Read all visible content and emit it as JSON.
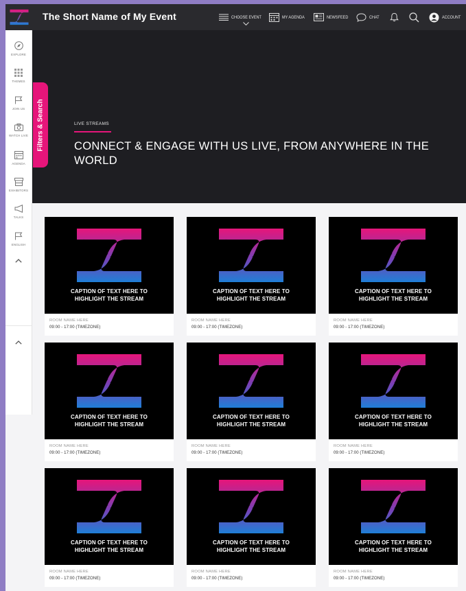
{
  "header": {
    "title": "The Short Name of My Event",
    "nav": [
      {
        "id": "choose-event",
        "label": "CHOOSE EVENT",
        "icon": "list-icon"
      },
      {
        "id": "my-agenda",
        "label": "MY AGENDA",
        "icon": "calendar-icon"
      },
      {
        "id": "newsfeed",
        "label": "NEWSFEED",
        "icon": "newspaper-icon"
      },
      {
        "id": "chat",
        "label": "CHAT",
        "icon": "chat-bubble-icon"
      },
      {
        "id": "notifications",
        "label": "",
        "icon": "bell-icon"
      },
      {
        "id": "search",
        "label": "",
        "icon": "search-icon"
      },
      {
        "id": "account",
        "label": "ACCOUNT",
        "icon": "user-avatar-icon"
      }
    ]
  },
  "sidebar": {
    "items": [
      {
        "label": "EXPLORE",
        "icon": "compass-icon"
      },
      {
        "label": "THEMES",
        "icon": "grid-icon"
      },
      {
        "label": "JOIN US",
        "icon": "flag-icon"
      },
      {
        "label": "WATCH LIVE",
        "icon": "camera-icon"
      },
      {
        "label": "AGENDA",
        "icon": "calendar-icon"
      },
      {
        "label": "EXHIBITORS",
        "icon": "booth-icon"
      },
      {
        "label": "TALKS",
        "icon": "megaphone-icon"
      },
      {
        "label": "ENGLISH",
        "icon": "flag-icon"
      }
    ],
    "collapse_icon": "chevron-up-icon"
  },
  "filters_tab": "Filters & Search",
  "hero": {
    "kicker": "LIVE STREAMS",
    "heading": "CONNECT & ENGAGE WITH US LIVE, FROM ANYWHERE IN THE WORLD"
  },
  "streams": [
    {
      "caption_line1": "CAPTION OF TEXT HERE TO",
      "caption_line2": "HIGHLIGHT THE STREAM",
      "room": "ROOM NAME HERE",
      "time": "09:00 - 17:00 (TIMEZONE)"
    },
    {
      "caption_line1": "CAPTION OF TEXT HERE TO",
      "caption_line2": "HIGHLIGHT THE STREAM",
      "room": "ROOM NAME HERE",
      "time": "09:00 - 17:00 (TIMEZONE)"
    },
    {
      "caption_line1": "CAPTION OF TEXT HERE TO",
      "caption_line2": "HIGHLIGHT THE STREAM",
      "room": "ROOM NAME HERE",
      "time": "09:00 - 17:00 (TIMEZONE)"
    },
    {
      "caption_line1": "CAPTION OF TEXT HERE TO",
      "caption_line2": "HIGHLIGHT THE STREAM",
      "room": "ROOM NAME HERE",
      "time": "09:00 - 17:00 (TIMEZONE)"
    },
    {
      "caption_line1": "CAPTION OF TEXT HERE TO",
      "caption_line2": "HIGHLIGHT THE STREAM",
      "room": "ROOM NAME HERE",
      "time": "09:00 - 17:00 (TIMEZONE)"
    },
    {
      "caption_line1": "CAPTION OF TEXT HERE TO",
      "caption_line2": "HIGHLIGHT THE STREAM",
      "room": "ROOM NAME HERE",
      "time": "09:00 - 17:00 (TIMEZONE)"
    },
    {
      "caption_line1": "CAPTION OF TEXT HERE TO",
      "caption_line2": "HIGHLIGHT THE STREAM",
      "room": "ROOM NAME HERE",
      "time": "09:00 - 17:00 (TIMEZONE)"
    },
    {
      "caption_line1": "CAPTION OF TEXT HERE TO",
      "caption_line2": "HIGHLIGHT THE STREAM",
      "room": "ROOM NAME HERE",
      "time": "09:00 - 17:00 (TIMEZONE)"
    },
    {
      "caption_line1": "CAPTION OF TEXT HERE TO",
      "caption_line2": "HIGHLIGHT THE STREAM",
      "room": "ROOM NAME HERE",
      "time": "09:00 - 17:00 (TIMEZONE)"
    }
  ],
  "colors": {
    "accent": "#e6157a",
    "logo_gradient_top": "#e6157a",
    "logo_gradient_bottom": "#1f7fd6",
    "header_bg": "#2a2a2e",
    "hero_bg": "#1e1e22"
  }
}
